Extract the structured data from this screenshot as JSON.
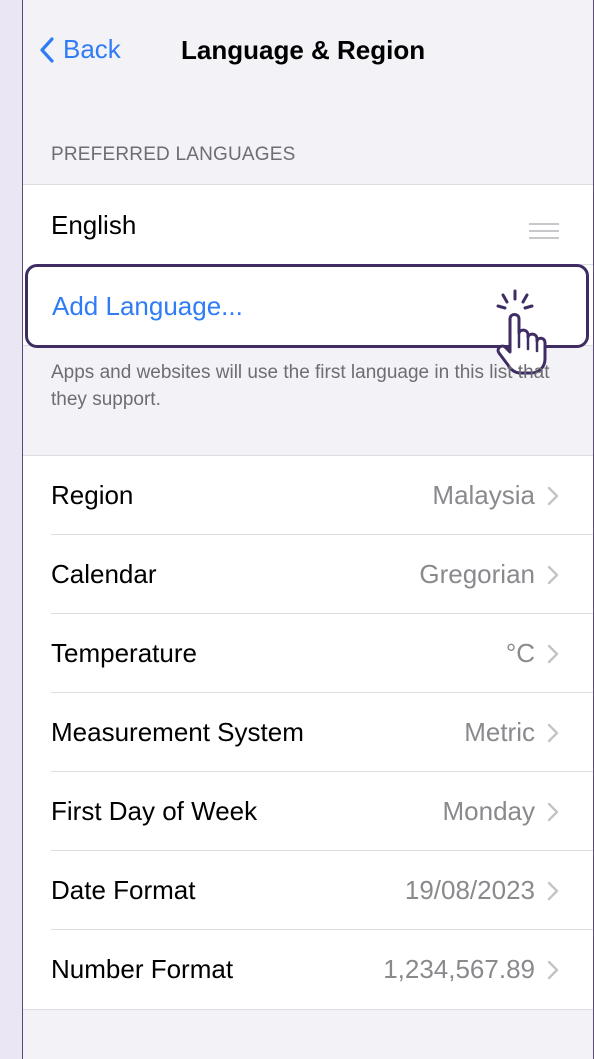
{
  "nav": {
    "back_label": "Back",
    "title": "Language & Region"
  },
  "preferred_languages": {
    "header": "PREFERRED LANGUAGES",
    "languages": [
      "English"
    ],
    "add_label": "Add Language...",
    "footnote": "Apps and websites will use the first language in this list that they support."
  },
  "settings": [
    {
      "label": "Region",
      "value": "Malaysia"
    },
    {
      "label": "Calendar",
      "value": "Gregorian"
    },
    {
      "label": "Temperature",
      "value": "°C"
    },
    {
      "label": "Measurement System",
      "value": "Metric"
    },
    {
      "label": "First Day of Week",
      "value": "Monday"
    },
    {
      "label": "Date Format",
      "value": "19/08/2023"
    },
    {
      "label": "Number Format",
      "value": "1,234,567.89"
    }
  ],
  "colors": {
    "accent": "#2f7cf6",
    "highlight_border": "#3e2c63",
    "page_background": "#ebe6f3"
  },
  "icons": [
    "chevron-left-icon",
    "drag-handle-icon",
    "chevron-right-icon",
    "hand-pointer-icon"
  ]
}
